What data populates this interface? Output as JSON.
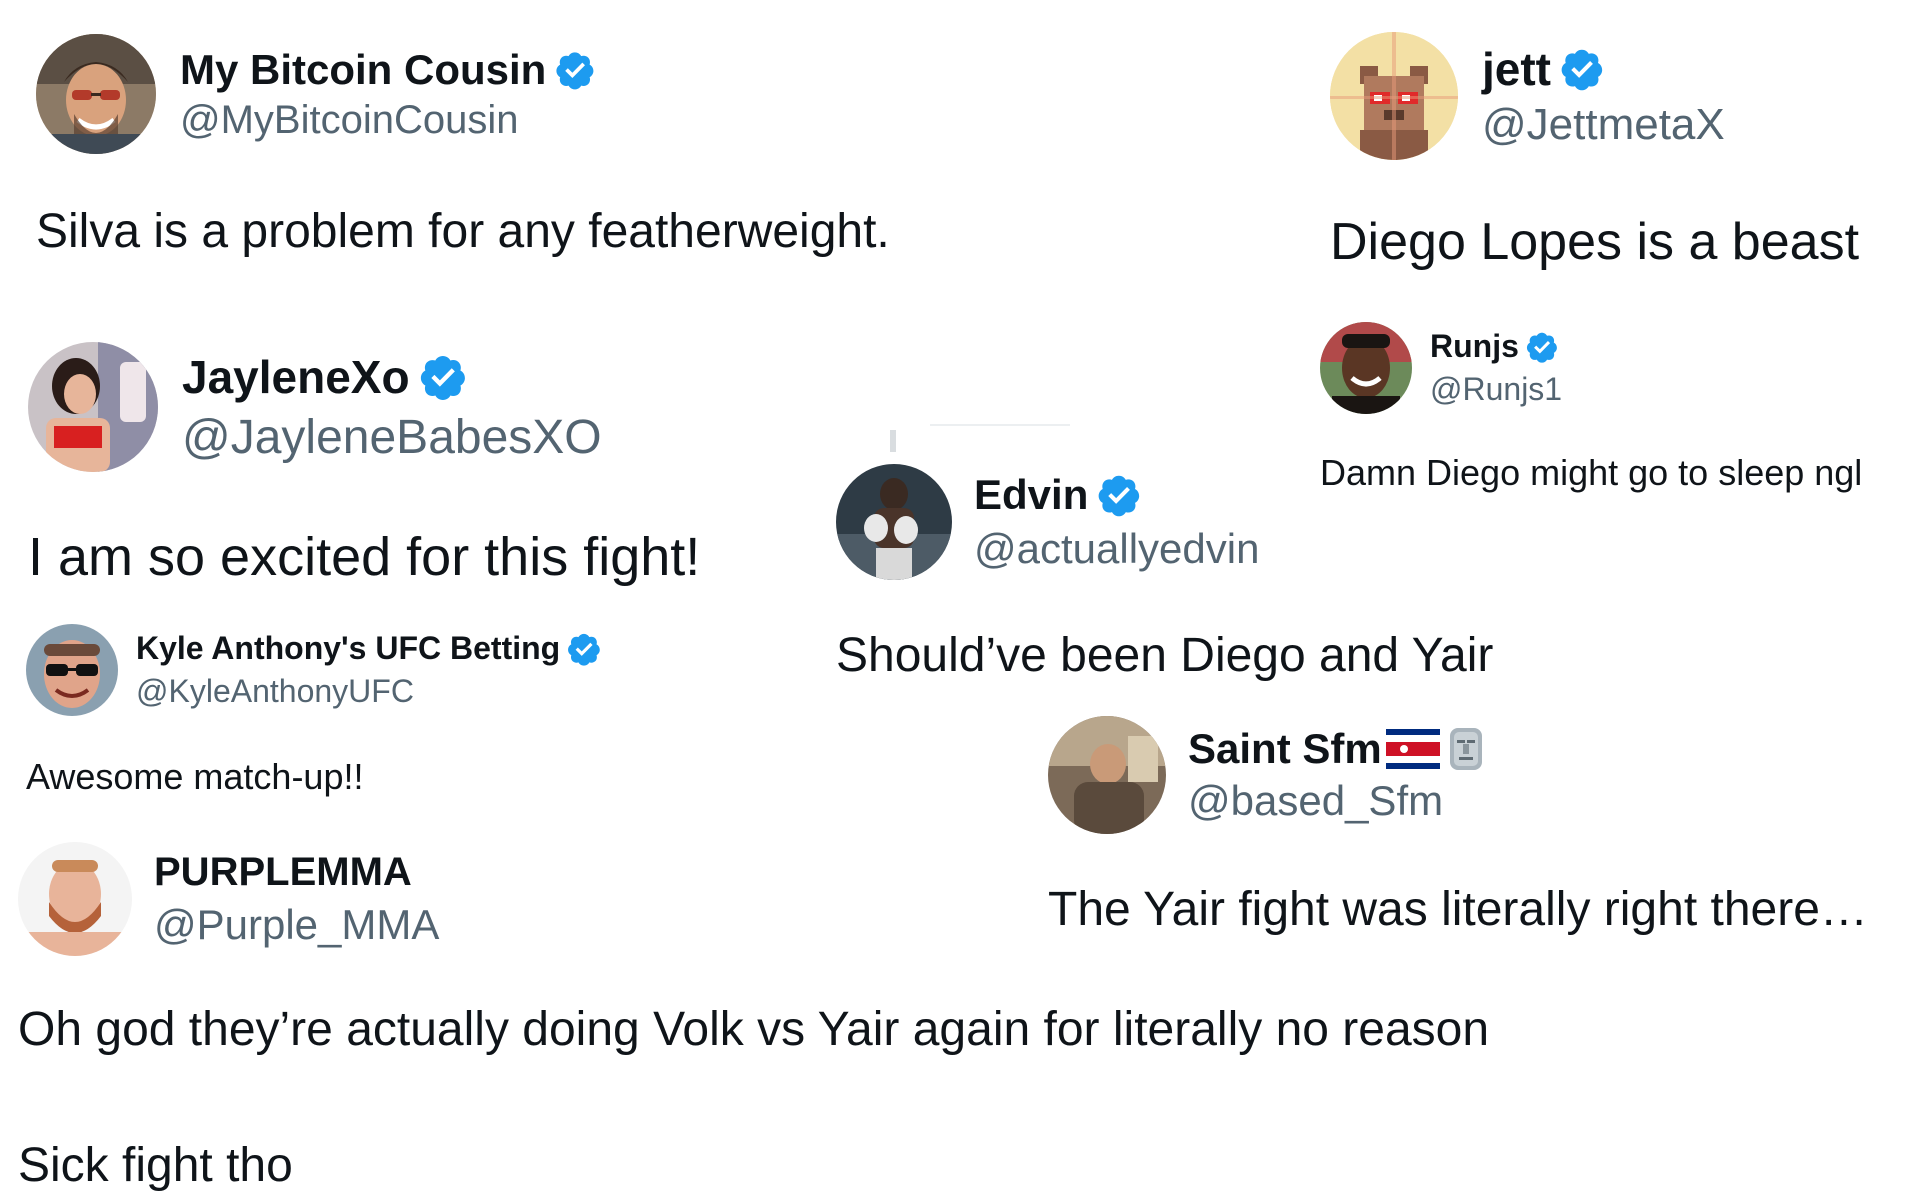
{
  "tweets": [
    {
      "name": "My Bitcoin Cousin",
      "handle": "@MyBitcoinCousin",
      "text": "Silva is a problem for any featherweight.",
      "verified": true,
      "avatar_icon": "man-with-sunglasses-avatar"
    },
    {
      "name": "jett",
      "handle": "@JettmetaX",
      "text": "Diego Lopes is a beast",
      "verified": true,
      "avatar_icon": "pixel-bear-avatar"
    },
    {
      "name": "JayleneXo",
      "handle": "@JayleneBabesXO",
      "text": "I am so excited for this fight!",
      "verified": true,
      "avatar_icon": "woman-photo-avatar"
    },
    {
      "name": "Runjs",
      "handle": "@Runjs1",
      "text": "Damn Diego might go to sleep ngl",
      "verified": true,
      "avatar_icon": "smiling-man-avatar"
    },
    {
      "name": "Edvin",
      "handle": "@actuallyedvin",
      "text": "Should’ve been Diego and Yair",
      "verified": true,
      "avatar_icon": "boxer-avatar"
    },
    {
      "name": "Kyle Anthony's UFC Betting",
      "handle": "@KyleAnthonyUFC",
      "text": "Awesome match-up!!",
      "verified": true,
      "avatar_icon": "man-with-sunglasses-avatar"
    },
    {
      "name": "Saint Sfm",
      "handle": "@based_Sfm",
      "text": "The Yair fight was literally right there…",
      "verified": false,
      "emojis": [
        "costa-rica-flag-icon",
        "moai-icon"
      ],
      "avatar_icon": "seated-man-avatar"
    },
    {
      "name": "PURPLEMMA",
      "handle": "@Purple_MMA",
      "text": "Oh god they’re actually doing Volk vs Yair again for literally no reason",
      "text2": "Sick fight tho",
      "verified": false,
      "avatar_icon": "bearded-fighter-avatar"
    }
  ],
  "colors": {
    "text": "#0f1419",
    "handle": "#536471",
    "verified_badge": "#1d9bf0"
  }
}
